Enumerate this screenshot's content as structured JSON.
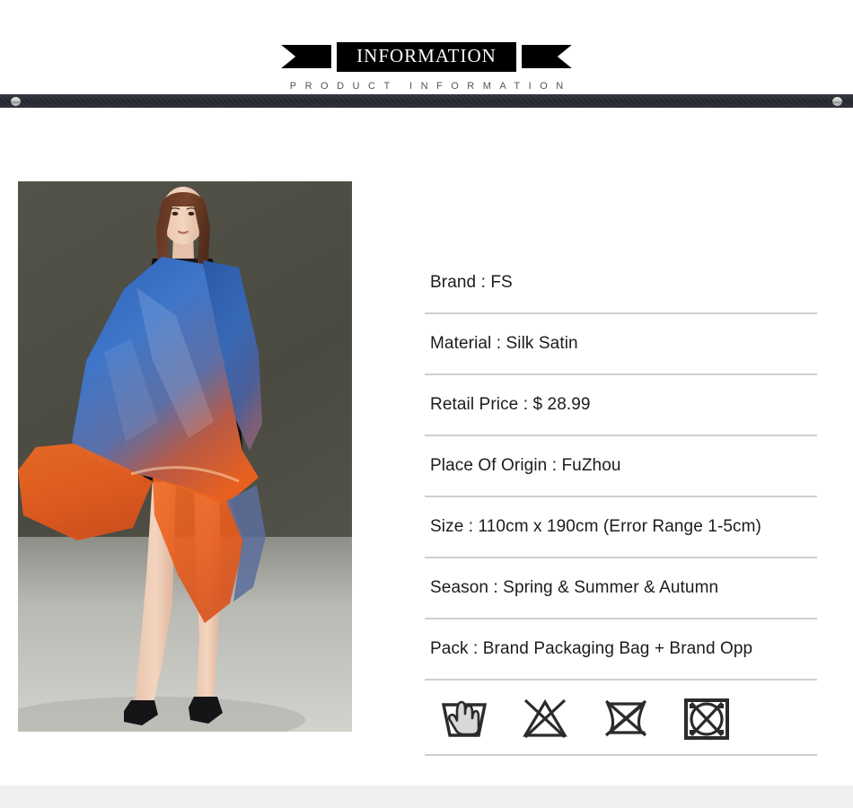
{
  "header": {
    "banner_title": "INFORMATION",
    "subtitle": "PRODUCT INFORMATION",
    "left_tail_icon": "ribbon-tail-left-icon",
    "right_tail_icon": "ribbon-tail-right-icon",
    "dot_left_icon": "bar-end-dot-left-icon",
    "dot_right_icon": "bar-end-dot-right-icon"
  },
  "product_photo": {
    "alt": "Model wearing blue to orange gradient silk satin scarf with black dress",
    "background_color": "#4a4a40",
    "floor_color": "#c9c9c4",
    "scarf_blue": "#2a5aa8",
    "scarf_orange": "#e8601f",
    "dress_color": "#0d0d0f",
    "hair_color": "#6b3a22"
  },
  "specs": [
    {
      "label": "Brand :",
      "value": "FS",
      "text": "Brand : FS"
    },
    {
      "label": "Material :",
      "value": "Silk Satin",
      "text": "Material :  Silk Satin"
    },
    {
      "label": "Retail Price :",
      "value": "$ 28.99",
      "text": "Retail Price : $ 28.99"
    },
    {
      "label": "Place Of Origin :",
      "value": "FuZhou",
      "text": "Place Of Origin : FuZhou"
    },
    {
      "label": "Size :",
      "value": "110cm x 190cm (Error Range 1-5cm)",
      "text": "Size : 110cm x 190cm (Error Range 1-5cm)"
    },
    {
      "label": "Season :",
      "value": "Spring & Summer & Autumn",
      "text": "Season :  Spring & Summer & Autumn"
    },
    {
      "label": "Pack :",
      "value": "Brand Packaging Bag + Brand Opp",
      "text": "Pack : Brand Packaging Bag + Brand Opp"
    }
  ],
  "care_symbols": [
    {
      "name": "hand-wash-icon",
      "meaning": "Hand wash"
    },
    {
      "name": "do-not-bleach-icon",
      "meaning": "Do not bleach"
    },
    {
      "name": "do-not-wring-icon",
      "meaning": "Do not wring"
    },
    {
      "name": "do-not-tumble-dry-icon",
      "meaning": "Do not tumble dry"
    }
  ],
  "colors": {
    "banner_background": "#000000",
    "banner_text": "#ffffff",
    "divider": "#cfcfcf",
    "bar": "#26292f",
    "body_text": "#1c1c1c",
    "footer": "#f0f0f0"
  }
}
